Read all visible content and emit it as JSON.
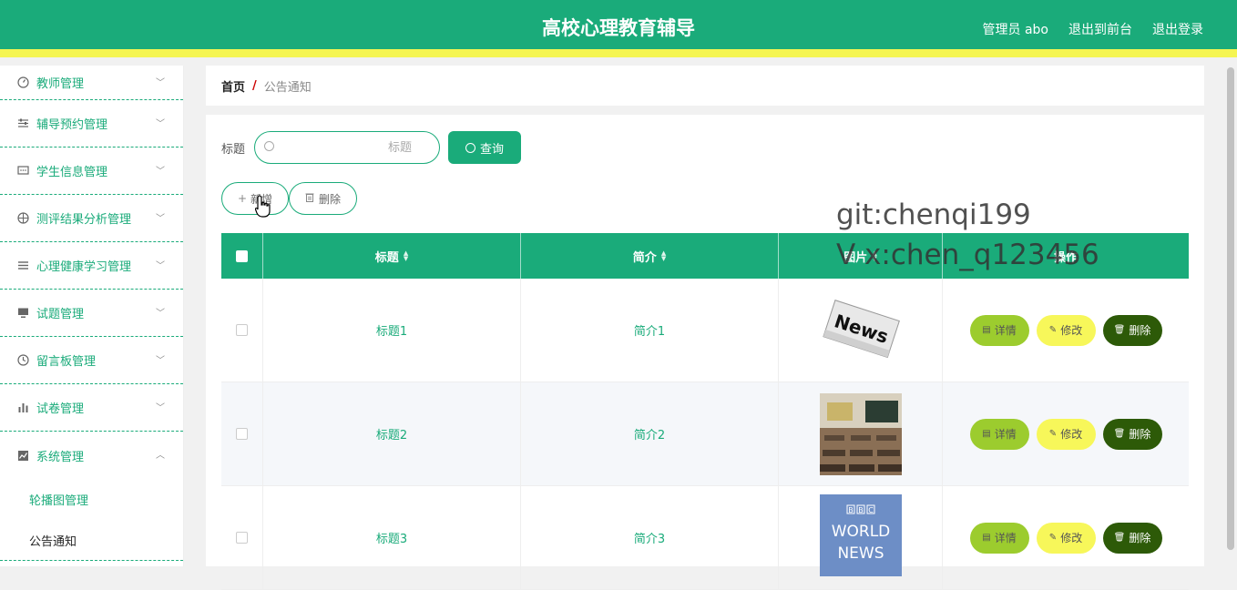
{
  "header": {
    "title": "高校心理教育辅导",
    "admin": "管理员 abo",
    "to_front": "退出到前台",
    "logout": "退出登录"
  },
  "sidebar": {
    "items": [
      {
        "label": "教师管理",
        "icon": "gauge-icon"
      },
      {
        "label": "辅导预约管理",
        "icon": "sliders-icon"
      },
      {
        "label": "学生信息管理",
        "icon": "chat-icon"
      },
      {
        "label": "测评结果分析管理",
        "icon": "target-icon"
      },
      {
        "label": "心理健康学习管理",
        "icon": "list-icon"
      },
      {
        "label": "试题管理",
        "icon": "monitor-icon"
      },
      {
        "label": "留言板管理",
        "icon": "clock-icon"
      },
      {
        "label": "试卷管理",
        "icon": "bar-chart-icon"
      },
      {
        "label": "系统管理",
        "icon": "line-chart-icon"
      }
    ],
    "sub_items": [
      {
        "label": "轮播图管理"
      },
      {
        "label": "公告通知"
      }
    ]
  },
  "breadcrumb": {
    "home": "首页",
    "separator": "/",
    "current": "公告通知"
  },
  "search": {
    "label": "标题",
    "placeholder": "标题",
    "button": "查询"
  },
  "actions": {
    "add": "新增",
    "delete": "删除"
  },
  "table": {
    "columns": [
      "标题",
      "简介",
      "图片",
      "操作"
    ],
    "rows": [
      {
        "title": "标题1",
        "intro": "简介1",
        "image": "news-newspaper"
      },
      {
        "title": "标题2",
        "intro": "简介2",
        "image": "classroom"
      },
      {
        "title": "标题3",
        "intro": "简介3",
        "image": "bbc-world-news"
      }
    ],
    "row_actions": {
      "detail": "详情",
      "edit": "修改",
      "delete": "删除"
    }
  },
  "watermark": {
    "line1": "git:chenqi199",
    "line2": "V x:chen_q123456"
  },
  "colors": {
    "primary": "#1aab7a",
    "accent_bar": "#f5f552",
    "detail_btn": "#9ccc2e",
    "edit_btn": "#f7f75a",
    "delete_btn": "#2d5a08"
  }
}
